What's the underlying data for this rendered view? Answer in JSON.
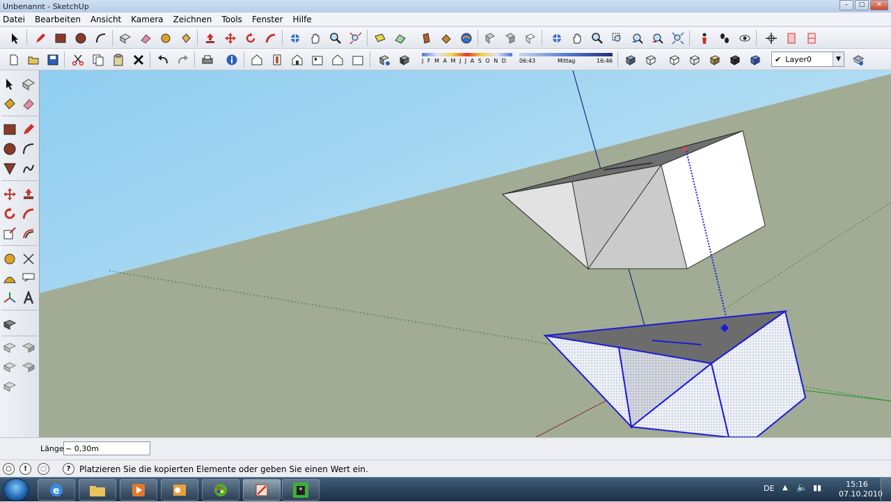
{
  "window": {
    "title": "Unbenannt - SketchUp"
  },
  "menu": [
    "Datei",
    "Bearbeiten",
    "Ansicht",
    "Kamera",
    "Zeichnen",
    "Tools",
    "Fenster",
    "Hilfe"
  ],
  "shadow": {
    "months": "J F M A M J J A S O N D",
    "time_start": "06:43",
    "time_mid": "Mittag",
    "time_end": "16:46"
  },
  "layer": {
    "current": "Layer0"
  },
  "measure": {
    "label": "Länge",
    "value": "~ 0,30m"
  },
  "status": {
    "message": "Platzieren Sie die kopierten Elemente oder geben Sie einen Wert ein."
  },
  "tray": {
    "lang": "DE",
    "time": "15:16",
    "date": "07.10.2010"
  },
  "colors": {
    "sky": "#a8d8f2",
    "ground": "#a2ab94",
    "edge_selected": "#1b1bd8",
    "face_gray": "#c8c8c8"
  }
}
